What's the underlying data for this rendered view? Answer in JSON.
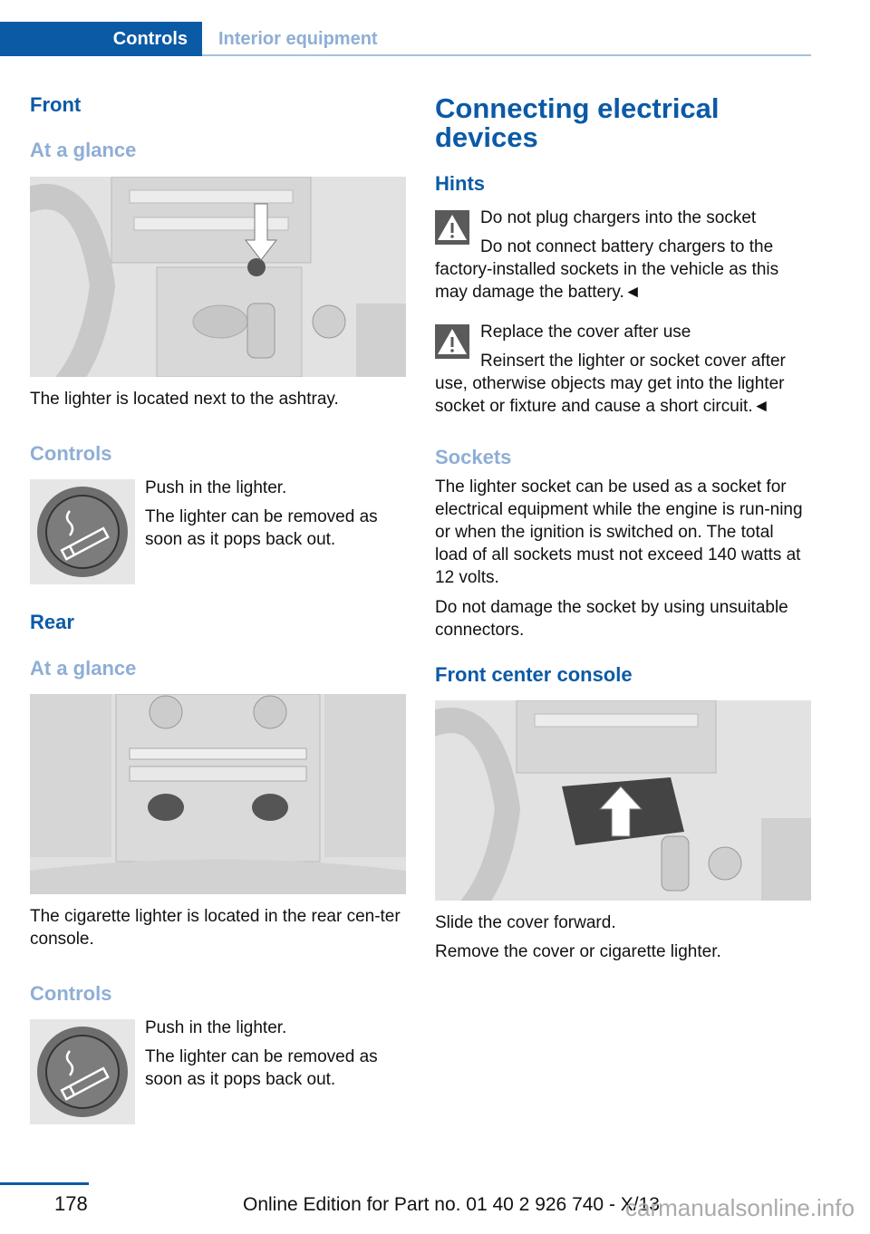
{
  "header": {
    "tab_active": "Controls",
    "tab_inactive": "Interior equipment"
  },
  "left": {
    "front_heading": "Front",
    "front_glance": "At a glance",
    "front_image_caption": "The lighter is located next to the ashtray.",
    "front_controls_heading": "Controls",
    "front_controls_lines": [
      "Push in the lighter.",
      "The lighter can be removed as soon as it pops back out."
    ],
    "rear_heading": "Rear",
    "rear_glance": "At a glance",
    "rear_image_caption": "The cigarette lighter is located in the rear cen-ter console.",
    "rear_controls_heading": "Controls",
    "rear_controls_lines": [
      "Push in the lighter.",
      "The lighter can be removed as soon as it pops back out."
    ]
  },
  "right": {
    "title": "Connecting electrical devices",
    "hints_heading": "Hints",
    "warnings": [
      {
        "title": "Do not plug chargers into the socket",
        "body": "Do not connect battery chargers to the factory-installed sockets in the vehicle as this may damage the battery.◄"
      },
      {
        "title": "Replace the cover after use",
        "body": "Reinsert the lighter or socket cover after use, otherwise objects may get into the lighter socket or fixture and cause a short circuit.◄"
      }
    ],
    "sockets_heading": "Sockets",
    "sockets_p1": "The lighter socket can be used as a socket for electrical equipment while the engine is run-ning or when the ignition is switched on. The total load of all sockets must not exceed 140 watts at 12 volts.",
    "sockets_p2": "Do not damage the socket by using unsuitable connectors.",
    "console_heading": "Front center console",
    "console_lines": [
      "Slide the cover forward.",
      "Remove the cover or cigarette lighter."
    ]
  },
  "footer": {
    "page_number": "178",
    "edition": "Online Edition for Part no. 01 40 2 926 740 - X/13",
    "watermark": "carmanualsonline.info"
  },
  "icons": {
    "warning": "warning-triangle-icon",
    "lighter": "cigarette-lighter-icon"
  }
}
